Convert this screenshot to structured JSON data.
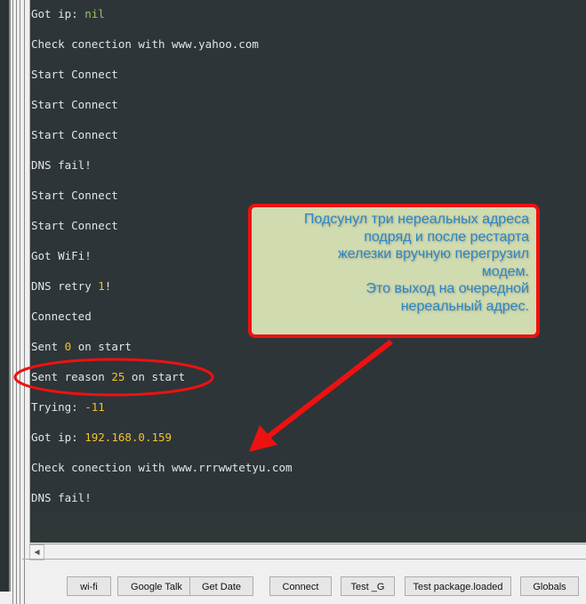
{
  "console": {
    "lines": [
      {
        "text": "Got ip: ",
        "value": "nil"
      },
      {
        "text": "Check conection with www.yahoo.com"
      },
      {
        "text": "Start Connect"
      },
      {
        "text": "Start Connect"
      },
      {
        "text": "Start Connect"
      },
      {
        "text": "DNS fail!"
      },
      {
        "text": "Start Connect"
      },
      {
        "text": "Start Connect"
      },
      {
        "text": "Got WiFi!"
      },
      {
        "text": "DNS retry ",
        "value": "1",
        "after": "!"
      },
      {
        "text": "Connected"
      },
      {
        "text": "Sent ",
        "value": "0",
        "after": " on start"
      },
      {
        "text": "Sent reason ",
        "value": "25",
        "after": " on start"
      },
      {
        "text": "Trying: ",
        "value": "-11"
      },
      {
        "text": "Got ip: ",
        "value": "192.168.0.159"
      },
      {
        "text": "Check conection with www.rrrwwtetyu.com"
      },
      {
        "text": "DNS fail!"
      }
    ]
  },
  "callout": {
    "lines": [
      "Подсунул три нереальных адреса",
      "подряд и после рестарта",
      "железки вручную перегрузил",
      "модем.",
      "Это выход на очередной",
      "нереальный адрес."
    ]
  },
  "buttons": [
    "wi-fi",
    "Google Talk",
    "Get Date",
    "Connect",
    "Test _G",
    "Test package.loaded",
    "Globals"
  ],
  "colors": {
    "annotation": "#ee1111",
    "callout_bg": "#d1dbb0",
    "callout_text": "#2c86c8",
    "console_bg": "#2d3538",
    "number": "#f2c12e"
  }
}
